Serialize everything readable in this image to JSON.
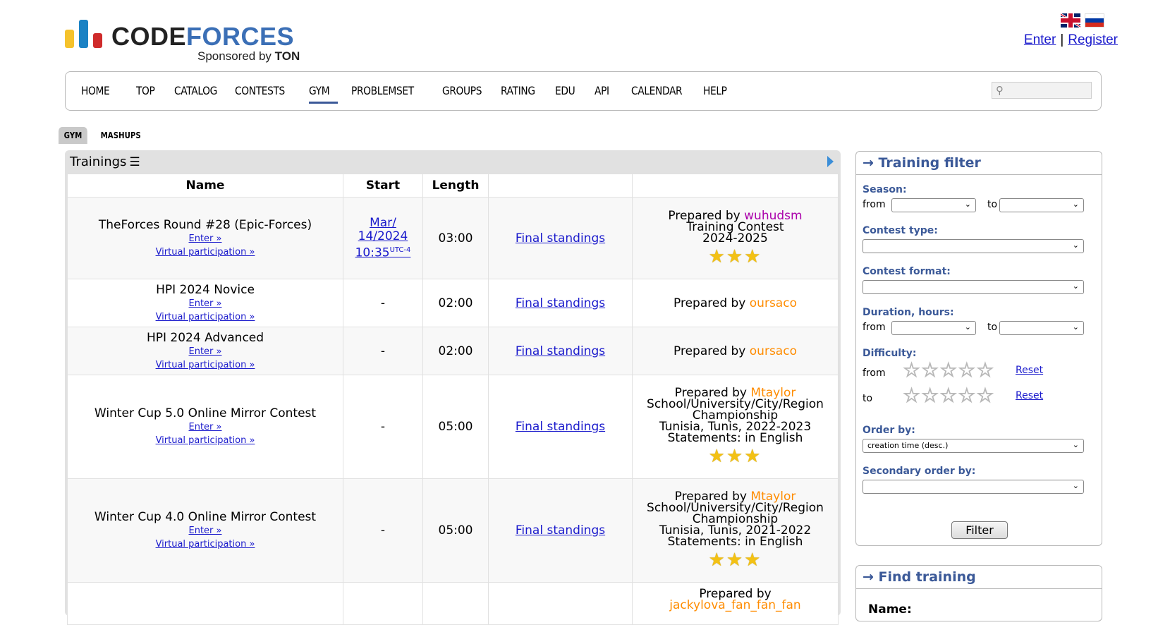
{
  "header": {
    "logo_code": "CODE",
    "logo_forces": "FORCES",
    "sponsored_prefix": "Sponsored by",
    "sponsor_name": "TON",
    "enter": "Enter",
    "separator": "|",
    "register": "Register"
  },
  "menu": {
    "items": [
      "HOME",
      "TOP",
      "CATALOG",
      "CONTESTS",
      "GYM",
      "PROBLEMSET",
      "GROUPS",
      "RATING",
      "EDU",
      "API",
      "CALENDAR",
      "HELP"
    ],
    "active": "GYM",
    "search_placeholder": ""
  },
  "subtabs": [
    "GYM",
    "MASHUPS"
  ],
  "trainings": {
    "title": "Trainings",
    "headers": [
      "Name",
      "Start",
      "Length",
      "",
      ""
    ],
    "enter_label": "Enter »",
    "virtual_label": "Virtual participation »",
    "standings_label": "Final standings",
    "prepared_by": "Prepared by",
    "rows": [
      {
        "name": "TheForces Round #28 (Epic-Forces)",
        "start_line1": "Mar/",
        "start_line2": "14/2024",
        "start_line3": "10:35",
        "start_tz": "UTC-4",
        "length": "03:00",
        "author": "wuhudsm",
        "info": [
          "Training Contest",
          "2024-2025"
        ],
        "stars": "★★★"
      },
      {
        "name": "HPI 2024 Novice",
        "start": "-",
        "length": "02:00",
        "author": "oursaco"
      },
      {
        "name": "HPI 2024 Advanced",
        "start": "-",
        "length": "02:00",
        "author": "oursaco"
      },
      {
        "name": "Winter Cup 5.0 Online Mirror Contest",
        "start": "-",
        "length": "05:00",
        "author": "Mtaylor",
        "info": [
          "School/University/City/Region",
          "Championship",
          "Tunisia, Tunis, 2022-2023",
          "Statements: in English"
        ],
        "stars": "★★★"
      },
      {
        "name": "Winter Cup 4.0 Online Mirror Contest",
        "start": "-",
        "length": "05:00",
        "author": "Mtaylor",
        "info": [
          "School/University/City/Region",
          "Championship",
          "Tunisia, Tunis, 2021-2022",
          "Statements: in English"
        ],
        "stars": "★★★"
      },
      {
        "author": "jackylova_fan_fan_fan"
      }
    ]
  },
  "filter": {
    "title": "→ Training filter",
    "season_label": "Season:",
    "from": "from",
    "to": "to",
    "contest_type_label": "Contest type:",
    "contest_format_label": "Contest format:",
    "duration_label": "Duration, hours:",
    "difficulty_label": "Difficulty:",
    "empty_stars": "☆☆☆☆☆",
    "reset": "Reset",
    "order_by_label": "Order by:",
    "order_by_value": "creation time (desc.)",
    "secondary_order_label": "Secondary order by:",
    "filter_button": "Filter"
  },
  "find": {
    "title": "→ Find training",
    "name_label": "Name:"
  },
  "colors": {
    "link": "#1a1acc",
    "brand_blue": "#3b5998",
    "author_purple": "#aa00aa",
    "author_orange": "#ff8c00",
    "star_gold": "#f3c114"
  }
}
